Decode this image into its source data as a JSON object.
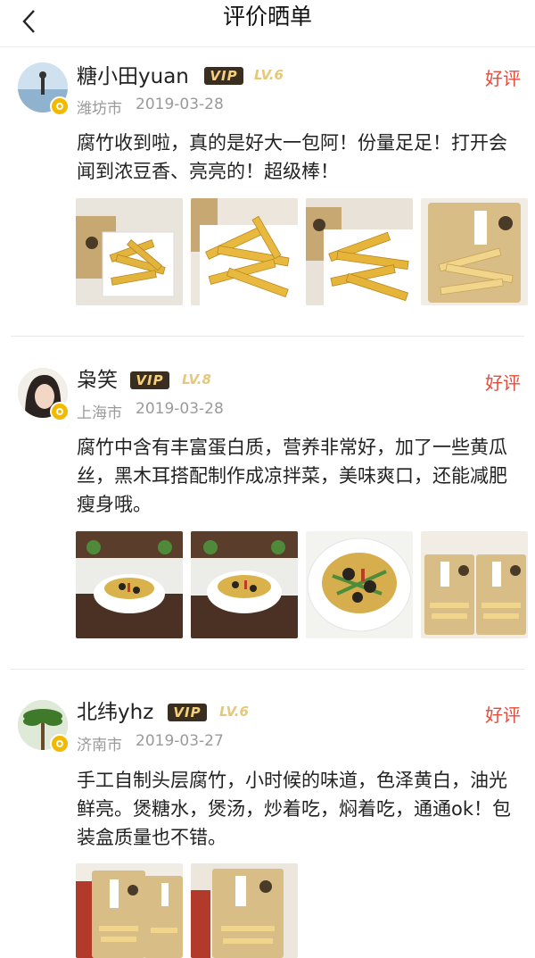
{
  "header": {
    "title": "评价晒单"
  },
  "reviews": [
    {
      "username": "糖小田yuan",
      "vip": "VIP",
      "level": "LV.6",
      "rating": "好评",
      "location": "潍坊市",
      "date": "2019-03-28",
      "text": "腐竹收到啦，真的是好大一包阿！份量足足！打开会闻到浓豆香、亮亮的！超级棒！"
    },
    {
      "username": "枭笑",
      "vip": "VIP",
      "level": "LV.8",
      "rating": "好评",
      "location": "上海市",
      "date": "2019-03-28",
      "text": "腐竹中含有丰富蛋白质，营养非常好，加了一些黄瓜丝，黑木耳搭配制作成凉拌菜，美味爽口，还能减肥瘦身哦。"
    },
    {
      "username": "北纬yhz",
      "vip": "VIP",
      "level": "LV.6",
      "rating": "好评",
      "location": "济南市",
      "date": "2019-03-27",
      "text": "手工自制头层腐竹，小时候的味道，色泽黄白，油光鲜亮。煲糖水，煲汤，炒着吃，焖着吃，通通ok！包装盒质量也不错。"
    }
  ],
  "colors": {
    "accent_red": "#e64b3c",
    "vip_bg": "#3a2e21",
    "vip_text": "#f5d07a",
    "level_text": "#e6c879",
    "meta_text": "#9a9a9a"
  },
  "icons": {
    "back": "chevron-left-icon",
    "verified": "verified-badge-icon"
  }
}
